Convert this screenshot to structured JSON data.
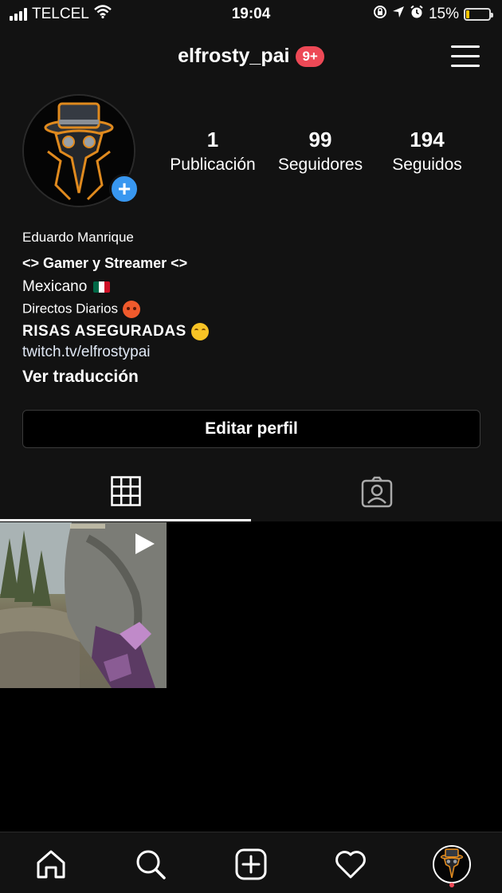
{
  "status_bar": {
    "carrier": "TELCEL",
    "time": "19:04",
    "battery_percent": "15%",
    "battery_level": 0.15,
    "battery_color": "#f5c400",
    "icons": [
      "signal-icon",
      "wifi-icon",
      "orientation-lock-icon",
      "location-icon",
      "alarm-icon",
      "battery-icon"
    ]
  },
  "header": {
    "username": "elfrosty_pai",
    "notification_badge": "9+",
    "badge_color": "#ed4956",
    "menu_icon": "hamburger-menu-icon"
  },
  "profile": {
    "avatar_icon": "plague-doctor-avatar",
    "add_story_icon": "plus-icon",
    "stats": [
      {
        "value": "1",
        "label": "Publicación"
      },
      {
        "value": "99",
        "label": "Seguidores"
      },
      {
        "value": "194",
        "label": "Seguidos"
      }
    ]
  },
  "bio": {
    "name": "Eduardo Manrique",
    "line1": "<> Gamer y Streamer <>",
    "line2": "Mexicano",
    "line3": "Directos Diarios",
    "line4": "RISAS ASEGURADAS",
    "link": "twitch.tv/elfrostypai",
    "translate": "Ver traducción",
    "emojis": [
      "mexico-flag-emoji",
      "hot-face-emoji",
      "hugging-face-emoji"
    ]
  },
  "edit_profile_label": "Editar perfil",
  "tabs": [
    {
      "name": "grid",
      "icon": "grid-icon",
      "active": true
    },
    {
      "name": "tagged",
      "icon": "tagged-person-icon",
      "active": false
    }
  ],
  "posts": [
    {
      "type": "video",
      "icon": "play-icon"
    }
  ],
  "bottom_nav": [
    "home-icon",
    "search-icon",
    "new-post-icon",
    "heart-icon",
    "profile-avatar"
  ],
  "accent_color": "#3897f0"
}
